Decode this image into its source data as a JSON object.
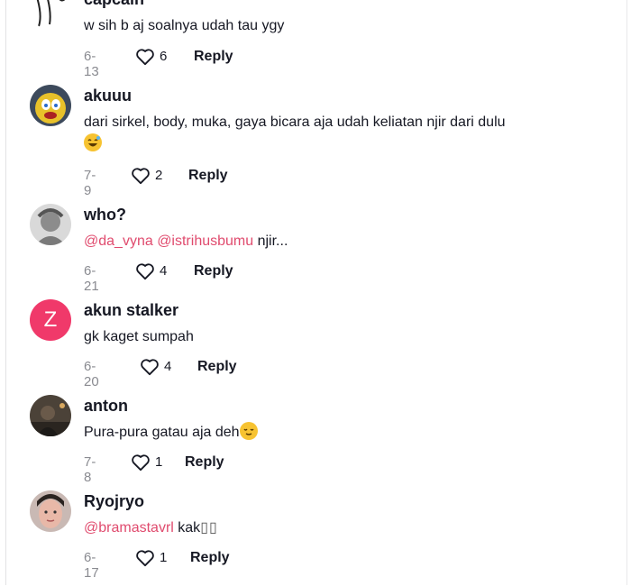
{
  "comments": [
    {
      "username": "capcaih",
      "text": "w sih b aj soalnya udah tau ygy",
      "date": "6-13",
      "likes": "6",
      "reply": "Reply"
    },
    {
      "username": "akuuu",
      "text": "dari sirkel, body, muka, gaya bicara aja udah keliatan njir dari dulu",
      "date": "7-9",
      "likes": "2",
      "reply": "Reply"
    },
    {
      "username": "who?",
      "mention1": "@da_vyna",
      "mention2": "@istrihusbumu",
      "text": "njir...",
      "date": "6-21",
      "likes": "4",
      "reply": "Reply"
    },
    {
      "username": "akun stalker",
      "avatar_letter": "Z",
      "text": "gk kaget sumpah",
      "date": "6-20",
      "likes": "4",
      "reply": "Reply"
    },
    {
      "username": "anton",
      "text": "Pura-pura gatau aja deh",
      "date": "7-8",
      "likes": "1",
      "reply": "Reply"
    },
    {
      "username": "Ryojryo",
      "mention1": "@bramastavrl",
      "text": "kak",
      "date": "6-17",
      "likes": "1",
      "reply": "Reply"
    }
  ],
  "colors": {
    "mention": "#e04b6e",
    "letter_avatar": "#f0396a",
    "date": "#8a8b91"
  },
  "icons": {
    "like": "heart-outline-icon"
  }
}
